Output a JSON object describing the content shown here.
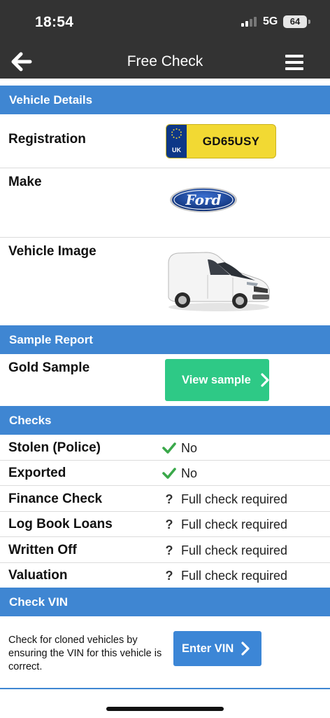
{
  "status": {
    "time": "18:54",
    "network": "5G",
    "battery": "64"
  },
  "nav": {
    "title": "Free Check"
  },
  "vehicle_details": {
    "heading": "Vehicle Details",
    "registration_label": "Registration",
    "plate_country": "UK",
    "registration": "GD65USY",
    "make_label": "Make",
    "make_logo_text": "Ford",
    "image_label": "Vehicle Image"
  },
  "sample_report": {
    "heading": "Sample Report",
    "gold_label": "Gold Sample",
    "view_button": "View sample"
  },
  "checks": {
    "heading": "Checks",
    "items": [
      {
        "label": "Stolen (Police)",
        "icon": "check-icon",
        "value": "No"
      },
      {
        "label": "Exported",
        "icon": "check-icon",
        "value": "No"
      },
      {
        "label": "Finance Check",
        "icon": "question-icon",
        "value": "Full check required"
      },
      {
        "label": "Log Book Loans",
        "icon": "question-icon",
        "value": "Full check required"
      },
      {
        "label": "Written Off",
        "icon": "question-icon",
        "value": "Full check required"
      },
      {
        "label": "Valuation",
        "icon": "question-icon",
        "value": "Full check required"
      }
    ]
  },
  "vin": {
    "heading": "Check VIN",
    "description": "Check for cloned vehicles by ensuring the VIN for this vehicle is correct.",
    "button": "Enter VIN"
  },
  "colors": {
    "header_bg": "#333333",
    "section_blue": "#3f86d2",
    "green_button": "#2ec986",
    "blue_button": "#3c86d6",
    "check_green": "#3aa84a"
  }
}
